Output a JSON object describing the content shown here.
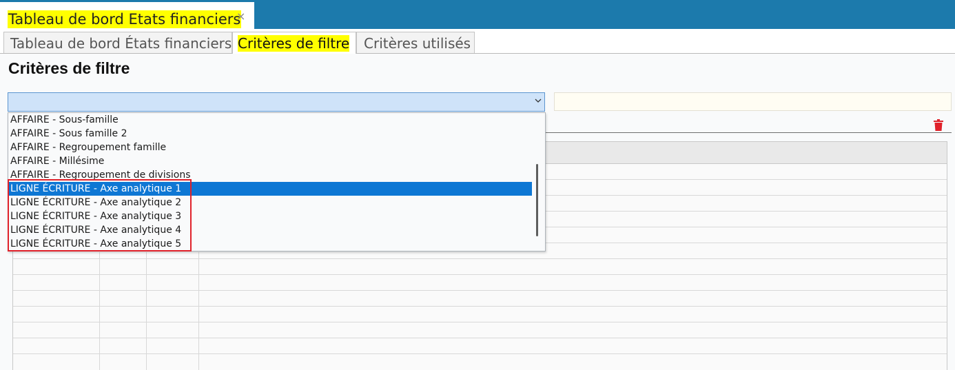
{
  "document_tab": {
    "title": "Tableau de bord Etats financiers",
    "close_icon": "×"
  },
  "subtabs": [
    {
      "label": "Tableau de bord États financiers"
    },
    {
      "label": "Critères de filtre",
      "active": true
    },
    {
      "label": "Critères utilisés"
    }
  ],
  "page_title": "Critères de filtre",
  "criteria_select": {
    "value": ""
  },
  "dropdown": {
    "options": [
      {
        "label": "AFFAIRE - Sous-famille"
      },
      {
        "label": "AFFAIRE - Sous famille 2"
      },
      {
        "label": "AFFAIRE - Regroupement famille"
      },
      {
        "label": "AFFAIRE - Millésime"
      },
      {
        "label": "AFFAIRE - Regroupement de divisions"
      },
      {
        "label": "LIGNE ÉCRITURE - Axe analytique 1",
        "selected": true
      },
      {
        "label": "LIGNE ÉCRITURE - Axe analytique 2"
      },
      {
        "label": "LIGNE ÉCRITURE - Axe analytique 3"
      },
      {
        "label": "LIGNE ÉCRITURE - Axe analytique 4"
      },
      {
        "label": "LIGNE ÉCRITURE - Axe analytique 5"
      }
    ]
  },
  "icons": {
    "delete": "trash-icon",
    "expand": "chevron-down-icon",
    "close": "close-icon"
  },
  "colors": {
    "header_bar": "#1c7aac",
    "highlight": "#ffff00",
    "selection": "#0e77d4",
    "annotation": "#e0212a",
    "delete_icon": "#e0212a"
  }
}
